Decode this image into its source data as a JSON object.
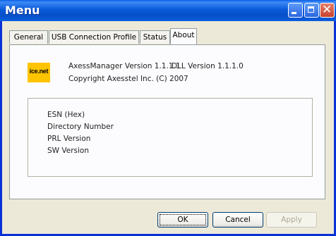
{
  "window": {
    "title": "Menu"
  },
  "titlebar_buttons": {
    "minimize": "minimize-icon",
    "maximize": "maximize-icon",
    "close": "close-icon",
    "close_glyph": "✕"
  },
  "tabs": [
    {
      "label": "General"
    },
    {
      "label": "USB Connection Profile"
    },
    {
      "label": "Status"
    },
    {
      "label": "About"
    }
  ],
  "active_tab": "About",
  "about": {
    "logo_text": "ice.net",
    "app_version": "AxessManager Version 1.1.1.1",
    "dll_version": "DLL Version 1.1.1.0",
    "copyright": "Copyright Axesstel Inc. (C) 2007"
  },
  "device_info": {
    "fields": [
      {
        "label": "ESN (Hex)"
      },
      {
        "label": "Directory Number"
      },
      {
        "label": "PRL Version"
      },
      {
        "label": "SW Version"
      }
    ]
  },
  "buttons": {
    "ok": "OK",
    "cancel": "Cancel",
    "apply": "Apply"
  },
  "colors": {
    "titlebar": "#0a5ad8",
    "logo_bg": "#ffc400",
    "window_bg": "#ece9d8"
  }
}
